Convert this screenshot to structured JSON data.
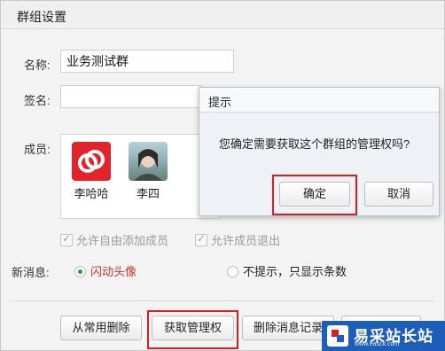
{
  "window": {
    "title": "群组设置"
  },
  "form": {
    "name_label": "名称:",
    "name_value": "业务测试群",
    "signature_label": "签名:",
    "signature_value": "",
    "members_label": "成员:",
    "members": [
      {
        "name": "李哈哈"
      },
      {
        "name": "李四"
      }
    ],
    "allow_add_label": "允许自由添加成员",
    "allow_exit_label": "允许成员退出",
    "new_msg_label": "新消息:",
    "flash_avatar_label": "闪动头像",
    "no_prompt_label": "不提示，只显示条数"
  },
  "buttons": {
    "remove_common": "从常用删除",
    "get_admin": "获取管理权",
    "delete_records": "删除消息记录"
  },
  "dialog": {
    "title": "提示",
    "message": "您确定需要获取这个群组的管理权吗?",
    "confirm": "确定",
    "cancel": "取消"
  },
  "watermark": {
    "text": "易采站长站",
    "sub": "www.easck.com"
  },
  "colors": {
    "highlight": "#e01b1b",
    "radio_selected": "#1aa260",
    "badge": "#1d5fb8"
  }
}
